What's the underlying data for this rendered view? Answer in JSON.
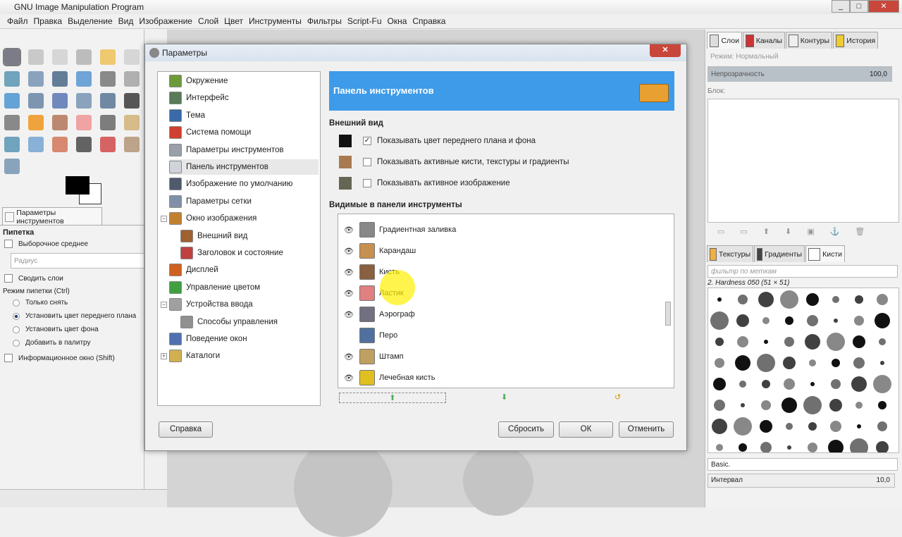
{
  "window": {
    "title": "GNU Image Manipulation Program",
    "controls": [
      "_",
      "□",
      "✕"
    ]
  },
  "menu": [
    "Файл",
    "Правка",
    "Выделение",
    "Вид",
    "Изображение",
    "Слой",
    "Цвет",
    "Инструменты",
    "Фильтры",
    "Script-Fu",
    "Окна",
    "Справка"
  ],
  "tool_options": {
    "tab": "Параметры инструментов",
    "tool": "Пипетка",
    "sample_average": "Выборочное среднее",
    "radius_placeholder": "Радиус",
    "sample_merged": "Сводить слои",
    "mode_label": "Режим пипетки  (Ctrl)",
    "modes": [
      "Только снять",
      "Установить цвет переднего плана",
      "Установить цвет фона",
      "Добавить в палитру"
    ],
    "selected_mode": 1,
    "info_window": "Информационное окно  (Shift)"
  },
  "dialog": {
    "title": "Параметры",
    "close": "✕",
    "tree": [
      {
        "label": "Окружение",
        "color": "#6a9a3a"
      },
      {
        "label": "Интерфейс",
        "color": "#5a7a5a"
      },
      {
        "label": "Тема",
        "color": "#3a6aa8"
      },
      {
        "label": "Система помощи",
        "color": "#d04030"
      },
      {
        "label": "Параметры инструментов",
        "color": "#9aa0a8"
      },
      {
        "label": "Панель инструментов",
        "color": "#d0d4da"
      },
      {
        "label": "Изображение по умолчанию",
        "color": "#505a6a"
      },
      {
        "label": "Параметры сетки",
        "color": "#8090a8"
      },
      {
        "label": "Окно изображения",
        "color": "#c08030"
      },
      {
        "label": "Внешний вид",
        "color": "#a06030"
      },
      {
        "label": "Заголовок и состояние",
        "color": "#c04040"
      },
      {
        "label": "Дисплей",
        "color": "#d06020"
      },
      {
        "label": "Управление цветом",
        "color": "#40a040"
      },
      {
        "label": "Устройства ввода",
        "color": "#a0a0a0"
      },
      {
        "label": "Способы управления",
        "color": "#909090"
      },
      {
        "label": "Поведение окон",
        "color": "#5070b0"
      },
      {
        "label": "Каталоги",
        "color": "#d0b050"
      }
    ],
    "header": "Панель инструментов",
    "appearance": "Внешний вид",
    "options": [
      {
        "label": "Показывать цвет переднего плана и фона",
        "checked": "✓"
      },
      {
        "label": "Показывать активные кисти, текстуры и градиенты",
        "checked": ""
      },
      {
        "label": "Показывать активное изображение",
        "checked": ""
      }
    ],
    "visible_label": "Видимые в панели инструменты",
    "tools": [
      {
        "label": "Градиентная заливка",
        "eye": "👁",
        "color": "#888"
      },
      {
        "label": "Карандаш",
        "eye": "👁",
        "color": "#c89050"
      },
      {
        "label": "Кисть",
        "eye": "👁",
        "color": "#8a6040"
      },
      {
        "label": "Ластик",
        "eye": "👁",
        "color": "#e08080"
      },
      {
        "label": "Аэрограф",
        "eye": "👁",
        "color": "#707080"
      },
      {
        "label": "Перо",
        "eye": "",
        "color": "#5070a0"
      },
      {
        "label": "Штамп",
        "eye": "👁",
        "color": "#c0a060"
      },
      {
        "label": "Лечебная кисть",
        "eye": "👁",
        "color": "#e0c020"
      }
    ],
    "buttons": {
      "help": "Справка",
      "reset": "Сбросить",
      "ok": "ОК",
      "cancel": "Отменить"
    }
  },
  "layers": {
    "tabs": [
      "Слои",
      "Каналы",
      "Контуры",
      "История"
    ],
    "mode": "Режим: Нормальный",
    "opacity_label": "Непрозрачность",
    "opacity": "100,0",
    "lock": "Блок:"
  },
  "brushes": {
    "tabs": [
      "Текстуры",
      "Градиенты",
      "Кисти"
    ],
    "filter_placeholder": "фильтр по меткам",
    "brush_name": "2. Hardness 050 (51 × 51)",
    "preset": "Basic.",
    "spacing_label": "Интервал",
    "spacing": "10,0"
  }
}
